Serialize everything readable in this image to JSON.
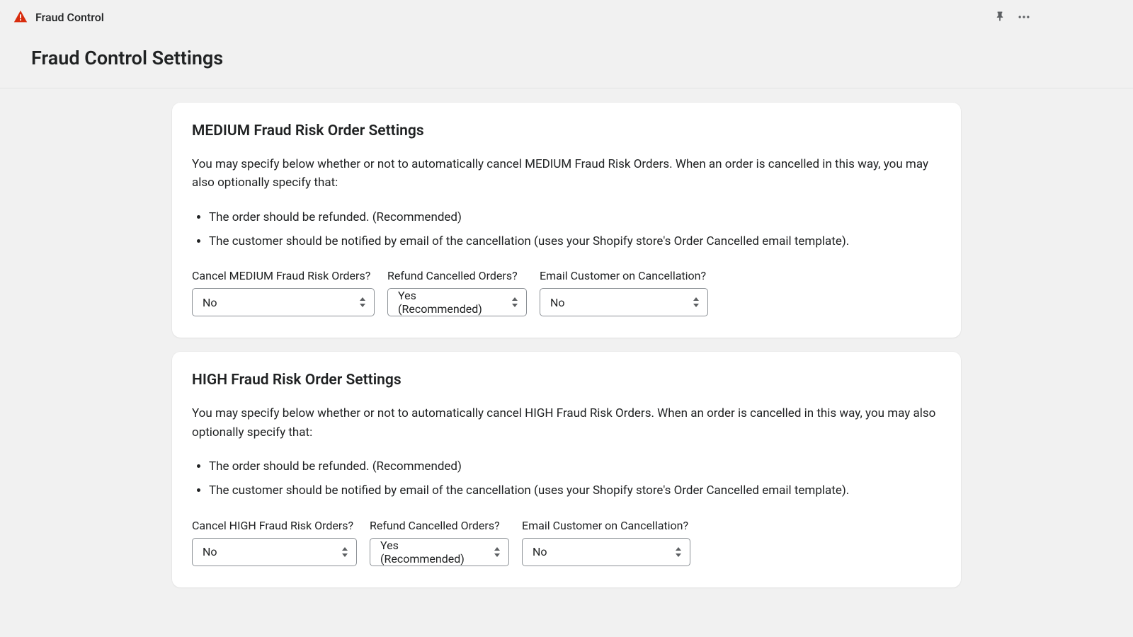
{
  "topbar": {
    "app_title": "Fraud Control"
  },
  "header": {
    "page_title": "Fraud Control Settings"
  },
  "cards": {
    "medium": {
      "title": "MEDIUM Fraud Risk Order Settings",
      "description": "You may specify below whether or not to automatically cancel MEDIUM Fraud Risk Orders. When an order is cancelled in this way, you may also optionally specify that:",
      "bullet1": "The order should be refunded. (Recommended)",
      "bullet2": "The customer should be notified by email of the cancellation (uses your Shopify store's Order Cancelled email template).",
      "cancel_label": "Cancel MEDIUM Fraud Risk Orders?",
      "cancel_value": "No",
      "refund_label": "Refund Cancelled Orders?",
      "refund_value": "Yes (Recommended)",
      "email_label": "Email Customer on Cancellation?",
      "email_value": "No"
    },
    "high": {
      "title": "HIGH Fraud Risk Order Settings",
      "description": "You may specify below whether or not to automatically cancel HIGH Fraud Risk Orders. When an order is cancelled in this way, you may also optionally specify that:",
      "bullet1": "The order should be refunded. (Recommended)",
      "bullet2": "The customer should be notified by email of the cancellation (uses your Shopify store's Order Cancelled email template).",
      "cancel_label": "Cancel HIGH Fraud Risk Orders?",
      "cancel_value": "No",
      "refund_label": "Refund Cancelled Orders?",
      "refund_value": "Yes (Recommended)",
      "email_label": "Email Customer on Cancellation?",
      "email_value": "No"
    }
  }
}
